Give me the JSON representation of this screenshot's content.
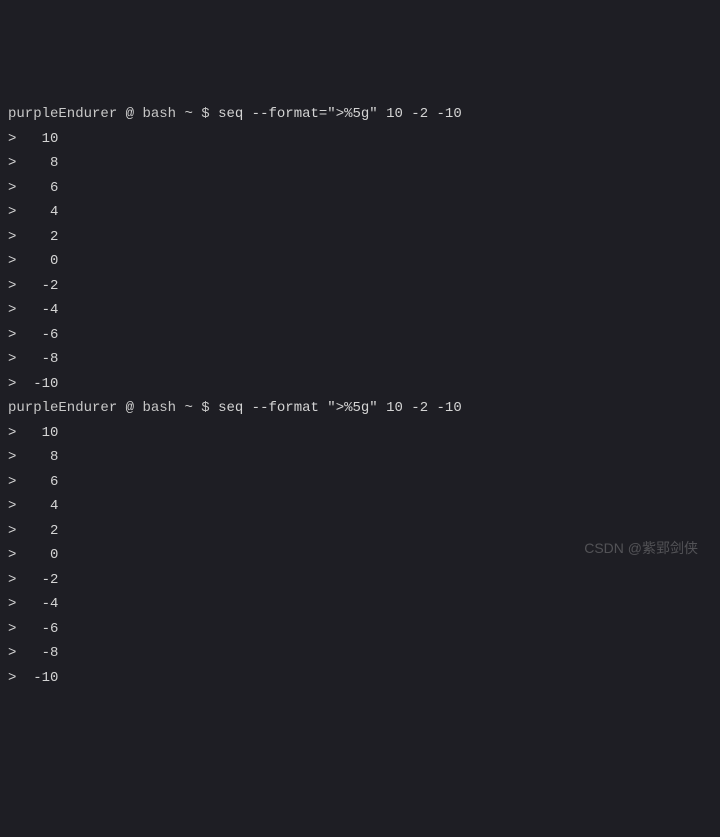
{
  "blocks": [
    {
      "prompt": {
        "user": "purpleEndurer",
        "at": "@",
        "shell": "bash",
        "path": "~",
        "symbol": "$"
      },
      "command": "seq --format=\">%5g\" 10 -2 -10",
      "output": [
        ">   10",
        ">    8",
        ">    6",
        ">    4",
        ">    2",
        ">    0",
        ">   -2",
        ">   -4",
        ">   -6",
        ">   -8",
        ">  -10"
      ]
    },
    {
      "prompt": {
        "user": "purpleEndurer",
        "at": "@",
        "shell": "bash",
        "path": "~",
        "symbol": "$"
      },
      "command": "seq --format \">%5g\" 10 -2 -10",
      "output": [
        ">   10",
        ">    8",
        ">    6",
        ">    4",
        ">    2",
        ">    0",
        ">   -2",
        ">   -4",
        ">   -6",
        ">   -8",
        ">  -10"
      ]
    }
  ],
  "watermark": "CSDN @紫郢剑侠"
}
